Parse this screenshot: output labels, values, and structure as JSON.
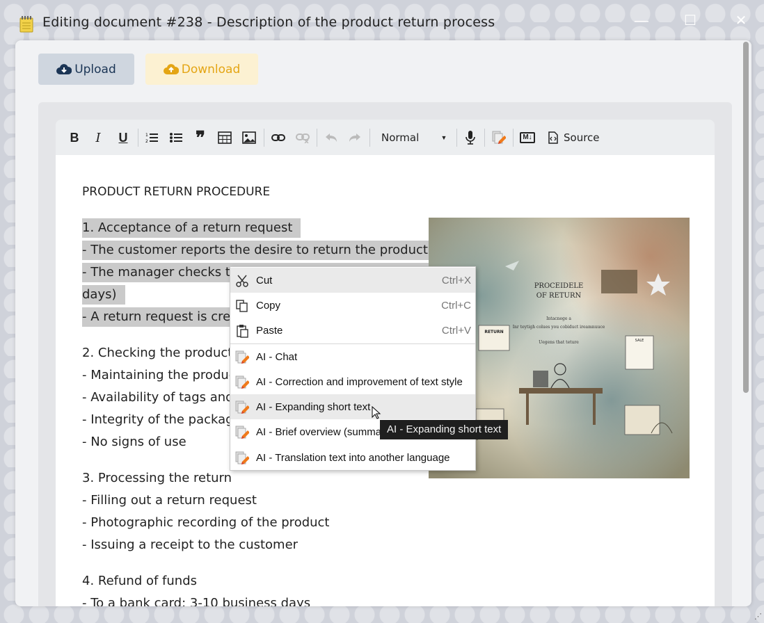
{
  "window": {
    "title": "Editing document #238 - Description of the product return process",
    "minimize": "—",
    "maximize": "☐",
    "close": "✕"
  },
  "actions": {
    "upload_label": "Upload",
    "download_label": "Download"
  },
  "toolbar": {
    "bold": "B",
    "italic": "I",
    "underline": "U",
    "quote": "❞",
    "style_value": "Normal",
    "source_label": "Source",
    "markdown": "M↓"
  },
  "document": {
    "heading": "PRODUCT RETURN PROCEDURE",
    "lines": [
      "1. Acceptance of a return request",
      "- The customer reports the desire to return the product",
      "- The manager checks the",
      "days)",
      "- A return request is creat",
      "2. Checking the product c",
      "- Maintaining the product",
      "- Availability of tags and l",
      "- Integrity of the packagin",
      "- No signs of use",
      "3. Processing the return",
      "- Filling out a return request",
      "- Photographic recording of the product",
      "- Issuing a receipt to the customer",
      "4. Refund of funds",
      "- To a bank card: 3-10 business days"
    ],
    "image": {
      "title_line1": "PROCEIDELE",
      "title_line2": "OF RETURN",
      "subtitle1": "Intacnege a",
      "subtitle2": "Inr teytigh colues you cobiduct ireamnuuce",
      "subtitle3": "Uegens that teture",
      "tag_return": "RETURN",
      "tag_sale": "SALE"
    }
  },
  "context_menu": {
    "items": [
      {
        "label": "Cut",
        "shortcut": "Ctrl+X"
      },
      {
        "label": "Copy",
        "shortcut": "Ctrl+C"
      },
      {
        "label": "Paste",
        "shortcut": "Ctrl+V"
      },
      {
        "label": "AI - Chat"
      },
      {
        "label": "AI - Correction and improvement of text style"
      },
      {
        "label": "AI - Expanding short text"
      },
      {
        "label": "AI - Brief overview (summa"
      },
      {
        "label": "AI - Translation text into another language"
      }
    ]
  },
  "tooltip": {
    "text": "AI - Expanding short text"
  }
}
